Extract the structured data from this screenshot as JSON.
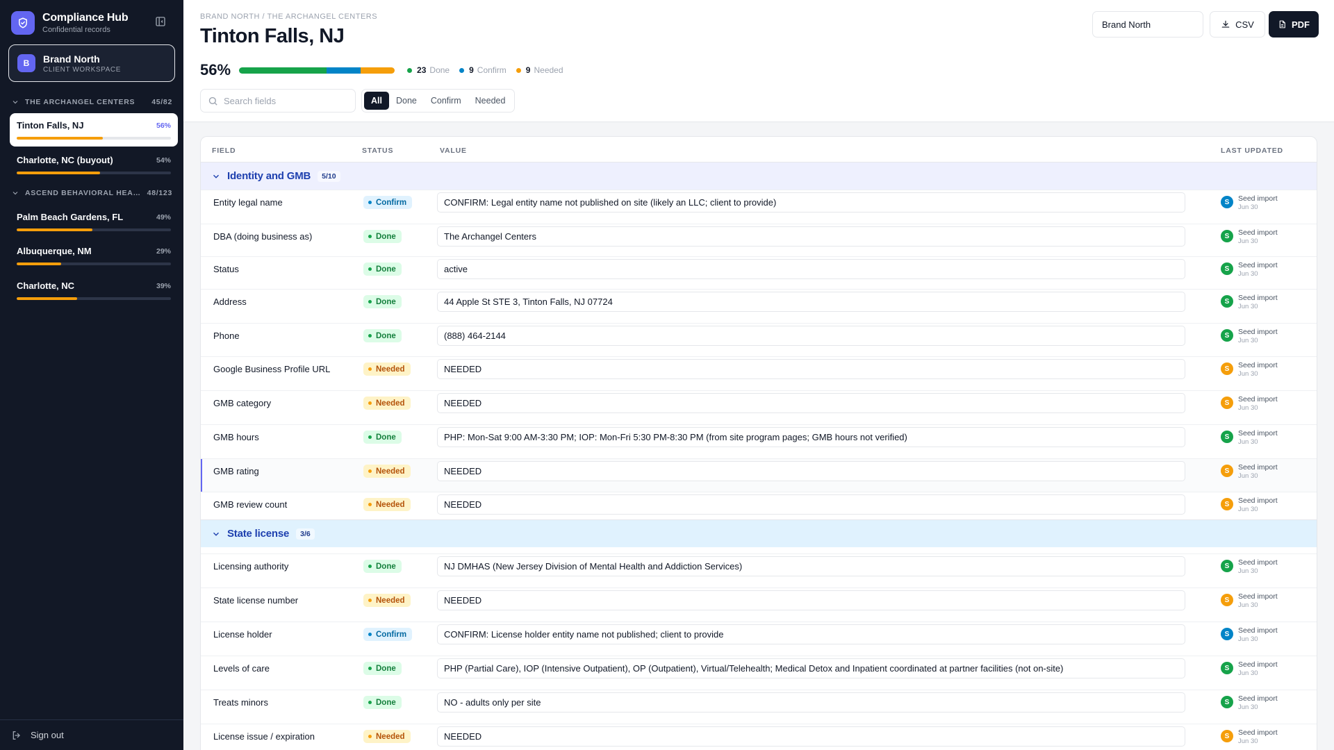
{
  "app": {
    "title": "Compliance Hub",
    "subtitle": "Confidential records"
  },
  "workspace": {
    "initial": "B",
    "name": "Brand North",
    "label": "CLIENT WORKSPACE"
  },
  "groups": [
    {
      "name": "THE ARCHANGEL CENTERS",
      "count": "45/82",
      "centers": [
        {
          "name": "Tinton Falls, NJ",
          "pct": "56%",
          "progress": 0.56,
          "active": true
        },
        {
          "name": "Charlotte, NC (buyout)",
          "pct": "54%",
          "progress": 0.54,
          "active": false
        }
      ]
    },
    {
      "name": "ASCEND BEHAVIORAL HEAL...",
      "count": "48/123",
      "centers": [
        {
          "name": "Palm Beach Gardens, FL",
          "pct": "49%",
          "progress": 0.49,
          "active": false
        },
        {
          "name": "Albuquerque, NM",
          "pct": "29%",
          "progress": 0.29,
          "active": false
        },
        {
          "name": "Charlotte, NC",
          "pct": "39%",
          "progress": 0.39,
          "active": false
        }
      ]
    }
  ],
  "signout_label": "Sign out",
  "breadcrumb": "BRAND NORTH / THE ARCHANGEL CENTERS",
  "page_title": "Tinton Falls, NJ",
  "summary": {
    "pct_label": "56%",
    "done": 23,
    "confirm": 9,
    "needed": 9,
    "done_label": "Done",
    "confirm_label": "Confirm",
    "needed_label": "Needed"
  },
  "search": {
    "placeholder": "Search fields",
    "value": ""
  },
  "filters": [
    "All",
    "Done",
    "Confirm",
    "Needed"
  ],
  "active_filter": "All",
  "header_actions": {
    "workspace_select": "Brand North",
    "csv_label": "CSV",
    "pdf_label": "PDF"
  },
  "columns": [
    "FIELD",
    "STATUS",
    "VALUE",
    "LAST UPDATED"
  ],
  "status_labels": {
    "done": "Done",
    "confirm": "Confirm",
    "needed": "Needed"
  },
  "colors": {
    "accent": "#6366f1",
    "done": "#16a34a",
    "confirm": "#0284c7",
    "needed": "#f59e0b",
    "section_identity": "#eef0fe",
    "section_license": "#e0f2fe"
  },
  "sections": [
    {
      "title": "Identity and GMB",
      "count": "5/10",
      "rows": [
        {
          "field": "Entity legal name",
          "status": "confirm",
          "value": "CONFIRM: Legal entity name not published on site (likely an LLC; client to provide)",
          "updated_by": "Seed import",
          "updated_on": "Jun 30"
        },
        {
          "field": "DBA (doing business as)",
          "status": "done",
          "value": "The Archangel Centers",
          "updated_by": "Seed import",
          "updated_on": "Jun 30"
        },
        {
          "field": "Status",
          "status": "done",
          "value": "active",
          "updated_by": "Seed import",
          "updated_on": "Jun 30"
        },
        {
          "field": "Address",
          "status": "done",
          "value": "44 Apple St STE 3, Tinton Falls, NJ 07724",
          "updated_by": "Seed import",
          "updated_on": "Jun 30"
        },
        {
          "field": "Phone",
          "status": "done",
          "value": "(888) 464-2144",
          "updated_by": "Seed import",
          "updated_on": "Jun 30"
        },
        {
          "field": "Google Business Profile URL",
          "status": "needed",
          "value": "NEEDED",
          "updated_by": "Seed import",
          "updated_on": "Jun 30"
        },
        {
          "field": "GMB category",
          "status": "needed",
          "value": "NEEDED",
          "updated_by": "Seed import",
          "updated_on": "Jun 30"
        },
        {
          "field": "GMB hours",
          "status": "done",
          "value": "PHP: Mon-Sat 9:00 AM-3:30 PM; IOP: Mon-Fri 5:30 PM-8:30 PM (from site program pages; GMB hours not verified)",
          "updated_by": "Seed import",
          "updated_on": "Jun 30"
        },
        {
          "field": "GMB rating",
          "status": "needed",
          "value": "NEEDED",
          "updated_by": "Seed import",
          "updated_on": "Jun 30",
          "highlight": true
        },
        {
          "field": "GMB review count",
          "status": "needed",
          "value": "NEEDED",
          "updated_by": "Seed import",
          "updated_on": "Jun 30"
        }
      ]
    },
    {
      "title": "State license",
      "count": "3/6",
      "rows": [
        {
          "field": "Licensing authority",
          "status": "done",
          "value": "NJ DMHAS (New Jersey Division of Mental Health and Addiction Services)",
          "updated_by": "Seed import",
          "updated_on": "Jun 30"
        },
        {
          "field": "State license number",
          "status": "needed",
          "value": "NEEDED",
          "updated_by": "Seed import",
          "updated_on": "Jun 30"
        },
        {
          "field": "License holder",
          "status": "confirm",
          "value": "CONFIRM: License holder entity name not published; client to provide",
          "updated_by": "Seed import",
          "updated_on": "Jun 30"
        },
        {
          "field": "Levels of care",
          "status": "done",
          "value": "PHP (Partial Care), IOP (Intensive Outpatient), OP (Outpatient), Virtual/Telehealth; Medical Detox and Inpatient coordinated at partner facilities (not on-site)",
          "updated_by": "Seed import",
          "updated_on": "Jun 30"
        },
        {
          "field": "Treats minors",
          "status": "done",
          "value": "NO - adults only per site",
          "updated_by": "Seed import",
          "updated_on": "Jun 30"
        },
        {
          "field": "License issue / expiration",
          "status": "needed",
          "value": "NEEDED",
          "updated_by": "Seed import",
          "updated_on": "Jun 30"
        }
      ]
    }
  ]
}
